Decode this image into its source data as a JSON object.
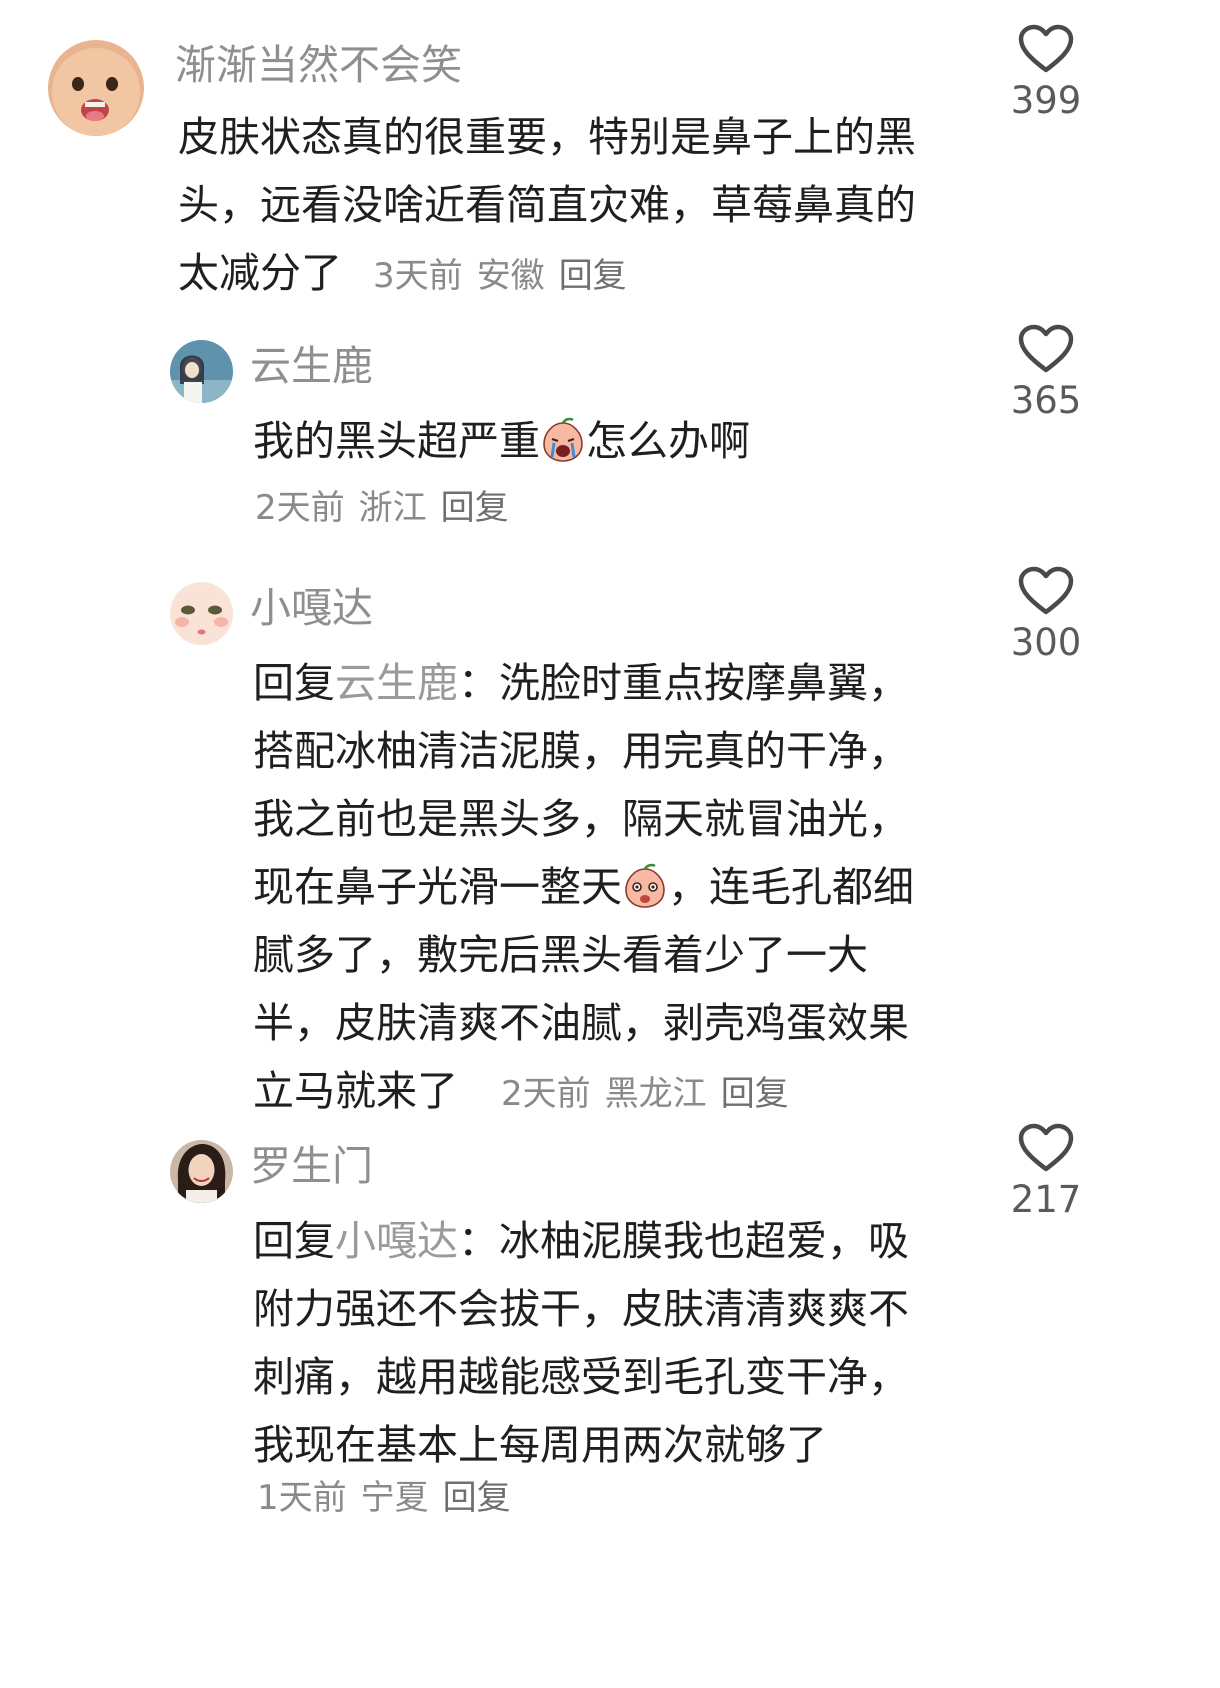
{
  "comments": [
    {
      "username": "渐渐当然不会笑",
      "text": "皮肤状态真的很重要，特别是鼻子上的黑头，远看没啥近看简直灾难，草莓鼻真的太减分了",
      "time": "3天前",
      "location": "安徽",
      "reply_label": "回复",
      "likes": "399",
      "avatar_icon": "baby-face-avatar"
    },
    {
      "username": "云生鹿",
      "text_before_emoji": "我的黑头超严重",
      "emoji_icon": "crying-peach-emoji",
      "text_after_emoji": "怎么办啊",
      "time": "2天前",
      "location": "浙江",
      "reply_label": "回复",
      "likes": "365",
      "avatar_icon": "illustrated-girl-avatar"
    },
    {
      "username": "小嘎达",
      "reply_prefix": "回复",
      "mention": "云生鹿",
      "colon": "：",
      "text_before_emoji": "洗脸时重点按摩鼻翼，搭配冰柚清洁泥膜，用完真的干净，我之前也是黑头多，隔天就冒油光，现在鼻子光滑一整天",
      "emoji_icon": "shy-peach-emoji",
      "text_after_emoji": "，连毛孔都细腻多了，敷完后黑头看着少了一大半，皮肤清爽不油腻，剥壳鸡蛋效果立马就来了",
      "time": "2天前",
      "location": "黑龙江",
      "reply_label": "回复",
      "likes": "300",
      "avatar_icon": "doll-face-avatar"
    },
    {
      "username": "罗生门",
      "reply_prefix": "回复",
      "mention": "小嘎达",
      "colon": "：",
      "text": "冰柚泥膜我也超爱，吸附力强还不会拔干，皮肤清清爽爽不刺痛，越用越能感受到毛孔变干净，我现在基本上每周用两次就够了",
      "time": "1天前",
      "location": "宁夏",
      "reply_label": "回复",
      "likes": "217",
      "avatar_icon": "woman-portrait-avatar"
    }
  ],
  "colors": {
    "username": "#8f8f8f",
    "text": "#1f1f1f",
    "meta": "#8a8a8a",
    "heart_stroke": "#4a4a4a"
  }
}
